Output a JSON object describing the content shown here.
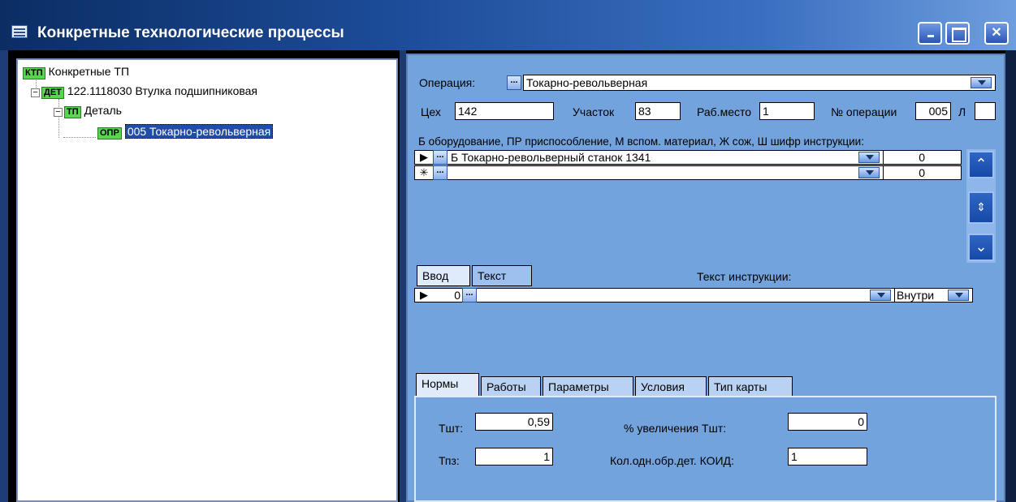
{
  "window": {
    "title": "Конкретные технологические процессы",
    "controls": {
      "minimize": "–",
      "maximize": "□",
      "close": "✕"
    }
  },
  "tree": {
    "root": {
      "badge": "КТП",
      "label": "Конкретные ТП"
    },
    "detail": {
      "badge": "ДЕТ",
      "label": "122.1118030 Втулка подшипниковая",
      "expander": "−"
    },
    "tp": {
      "badge": "ТП",
      "label": "Деталь",
      "expander": "−"
    },
    "operation": {
      "badge": "ОПР",
      "label": "005 Токарно-револьверная"
    }
  },
  "form": {
    "operation_label": "Операция:",
    "operation_value": "Токарно-револьверная",
    "workshop_label": "Цех",
    "workshop_value": "142",
    "section_label": "Участок",
    "section_value": "83",
    "workplace_label": "Раб.место",
    "workplace_value": "1",
    "opnum_label": "№ операции",
    "opnum_value": "005",
    "l_label": "Л",
    "l_value": "",
    "legend": "Б оборудование, ПР приспособление, М вспом. материал, Ж сож, Ш шифр инструкции:",
    "equipment_rows": [
      {
        "indicator": "▶",
        "value": "Б Токарно-револьверный станок 1341",
        "num": "0"
      },
      {
        "indicator": "✳",
        "value": "",
        "num": "0"
      }
    ],
    "tab_input": "Ввод",
    "tab_text": "Текст",
    "instruction_label": "Текст инструкции:",
    "instruction_row": {
      "indicator": "▶",
      "num": "0",
      "position": "Внутри"
    }
  },
  "tabs": [
    "Нормы",
    "Работы",
    "Параметры",
    "Условия",
    "Тип карты"
  ],
  "norms": {
    "tsht_label": "Тшт:",
    "tsht_value": "0,59",
    "tpz_label": "Тпз:",
    "tpz_value": "1",
    "increase_label": "% увеличения Тшт:",
    "increase_value": "0",
    "koid_label": "Кол.одн.обр.дет. КОИД:",
    "koid_value": "1"
  }
}
